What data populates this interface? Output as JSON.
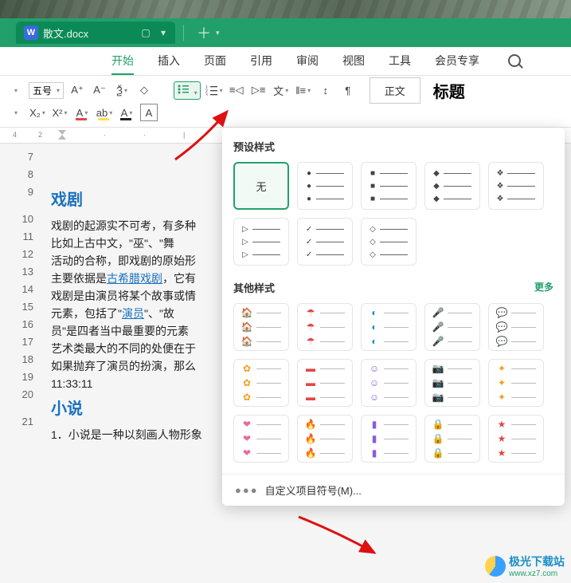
{
  "tab": {
    "doc_icon_letter": "W",
    "title": "散文.docx"
  },
  "menu": {
    "items": [
      "开始",
      "插入",
      "页面",
      "引用",
      "审阅",
      "视图",
      "工具",
      "会员专享"
    ],
    "active_index": 0
  },
  "toolbar": {
    "font_size_label": "五号",
    "style_normal": "正文",
    "style_heading": "标题"
  },
  "ruler": {
    "marks": [
      "4",
      "2"
    ],
    "positions": [
      16,
      48
    ]
  },
  "document": {
    "line_start": 7,
    "sections": [
      {
        "type": "blank",
        "n": 7
      },
      {
        "type": "blank",
        "n": 8
      },
      {
        "type": "heading",
        "n": 9,
        "text": "戏剧"
      },
      {
        "type": "para",
        "n": 10,
        "text": "戏剧的起源实不可考，有多种"
      },
      {
        "type": "para",
        "n": 11,
        "text": "比如上古中文，\"巫\"、\"舞"
      },
      {
        "type": "para",
        "n": 12,
        "text": "活动的合称，即戏剧的原始形"
      },
      {
        "type": "para",
        "n": 13,
        "text": "主要依据是",
        "link": "古希腊戏剧",
        "tail": "，它有"
      },
      {
        "type": "para",
        "n": 14,
        "text": "戏剧是由演员将某个故事或情"
      },
      {
        "type": "para",
        "n": 15,
        "text": "元素，包括了\"",
        "link": "演员",
        "tail": "\"、\"故"
      },
      {
        "type": "para",
        "n": 16,
        "text": "员\"是四者当中最重要的元素"
      },
      {
        "type": "para",
        "n": 17,
        "text": "艺术类最大的不同的处便在于"
      },
      {
        "type": "para",
        "n": 18,
        "text": "如果抛弃了演员的扮演，那么"
      },
      {
        "type": "para",
        "n": 19,
        "text": "11:33:11"
      },
      {
        "type": "heading",
        "n": 20,
        "text": "小说"
      },
      {
        "type": "para",
        "n": 21,
        "text": "1．小说是一种以刻画人物形象"
      }
    ]
  },
  "panel": {
    "preset_title": "预设样式",
    "none_label": "无",
    "other_title": "其他样式",
    "more_label": "更多",
    "custom_label": "自定义项目符号(M)...",
    "preset_marks": [
      "●",
      "■",
      "◆",
      "❖",
      "▷",
      "✓",
      "◇"
    ],
    "other_colors": [
      [
        "#1a8fc4",
        "🏠"
      ],
      [
        "#e04848",
        "☂"
      ],
      [
        "#1a8fc4",
        "◐"
      ],
      [
        "#e07a1a",
        "🎤"
      ],
      [
        "#22a06b",
        "💬"
      ],
      [
        "#f0a020",
        "✿"
      ],
      [
        "#e04848",
        "▬"
      ],
      [
        "#8a5adf",
        "☺"
      ],
      [
        "#22a06b",
        "📷"
      ],
      [
        "#f0a020",
        "✦"
      ],
      [
        "#e66aa0",
        "❤"
      ],
      [
        "#e04848",
        "🔥"
      ],
      [
        "#8a5adf",
        "▮"
      ],
      [
        "#22a06b",
        "🔒"
      ],
      [
        "#e04848",
        "★"
      ]
    ]
  },
  "watermark": {
    "name": "极光下载站",
    "url": "www.xz7.com"
  }
}
